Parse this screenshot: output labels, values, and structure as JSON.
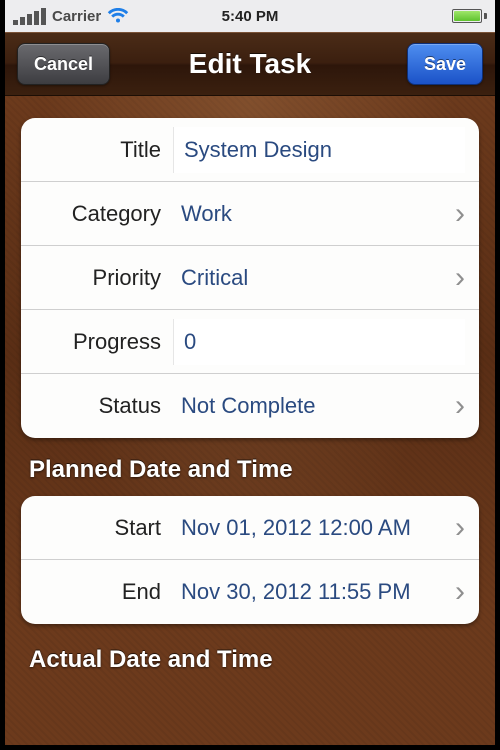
{
  "status": {
    "carrier": "Carrier",
    "time": "5:40 PM"
  },
  "nav": {
    "cancel": "Cancel",
    "title": "Edit Task",
    "save": "Save"
  },
  "fields": {
    "title": {
      "label": "Title",
      "value": "System Design"
    },
    "category": {
      "label": "Category",
      "value": "Work"
    },
    "priority": {
      "label": "Priority",
      "value": "Critical"
    },
    "progress": {
      "label": "Progress",
      "value": "0"
    },
    "status": {
      "label": "Status",
      "value": "Not Complete"
    }
  },
  "sections": {
    "planned": "Planned Date and Time",
    "actual": "Actual Date and Time"
  },
  "planned": {
    "start": {
      "label": "Start",
      "value": "Nov 01, 2012 12:00 AM"
    },
    "end": {
      "label": "End",
      "value": "Nov 30, 2012 11:55 PM"
    }
  }
}
